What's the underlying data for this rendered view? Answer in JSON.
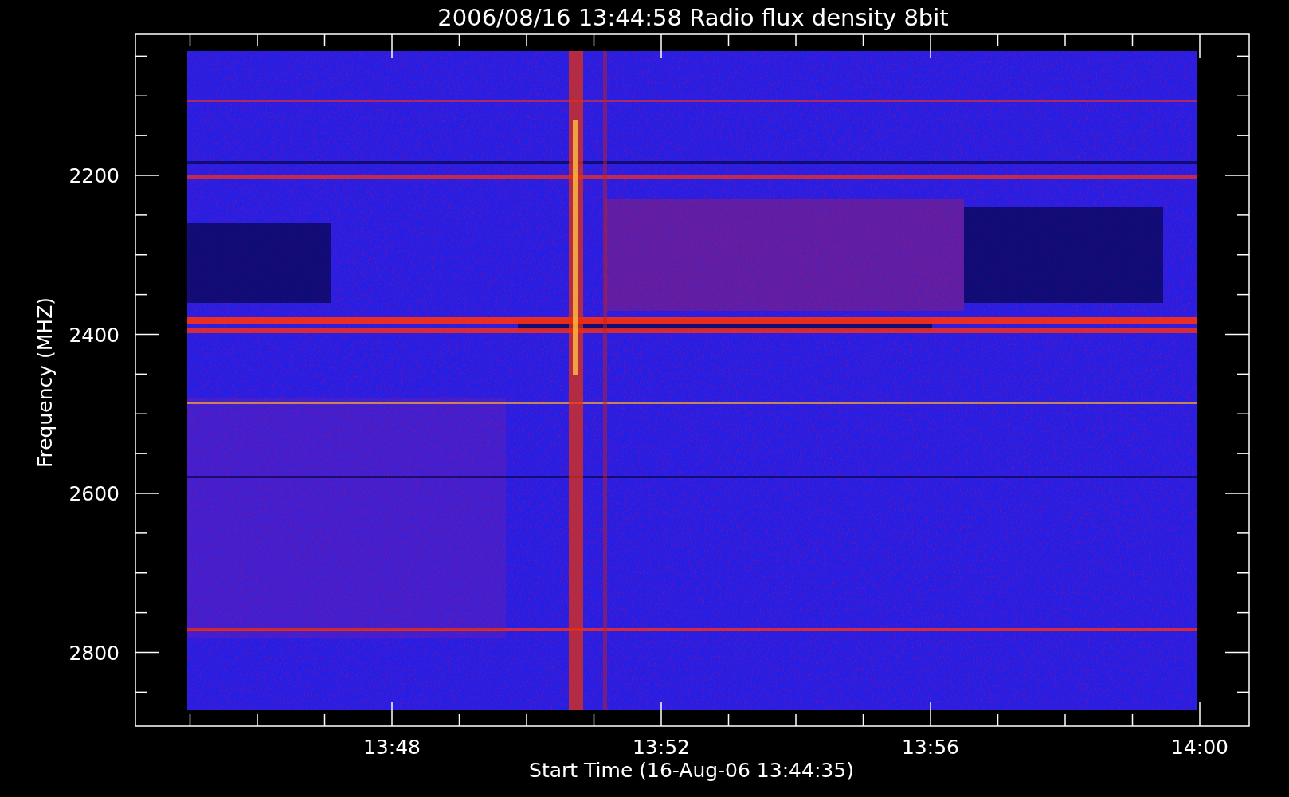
{
  "title": "2006/08/16 13:44:58 Radio flux density 8bit",
  "y_axis": {
    "label": "Frequency (MHZ)",
    "ticks": [
      "2200",
      "2400",
      "2600",
      "2800"
    ]
  },
  "x_axis": {
    "label": "Start Time (16-Aug-06 13:44:35)",
    "ticks": [
      "13:48",
      "13:52",
      "13:56",
      "14:00"
    ]
  }
}
